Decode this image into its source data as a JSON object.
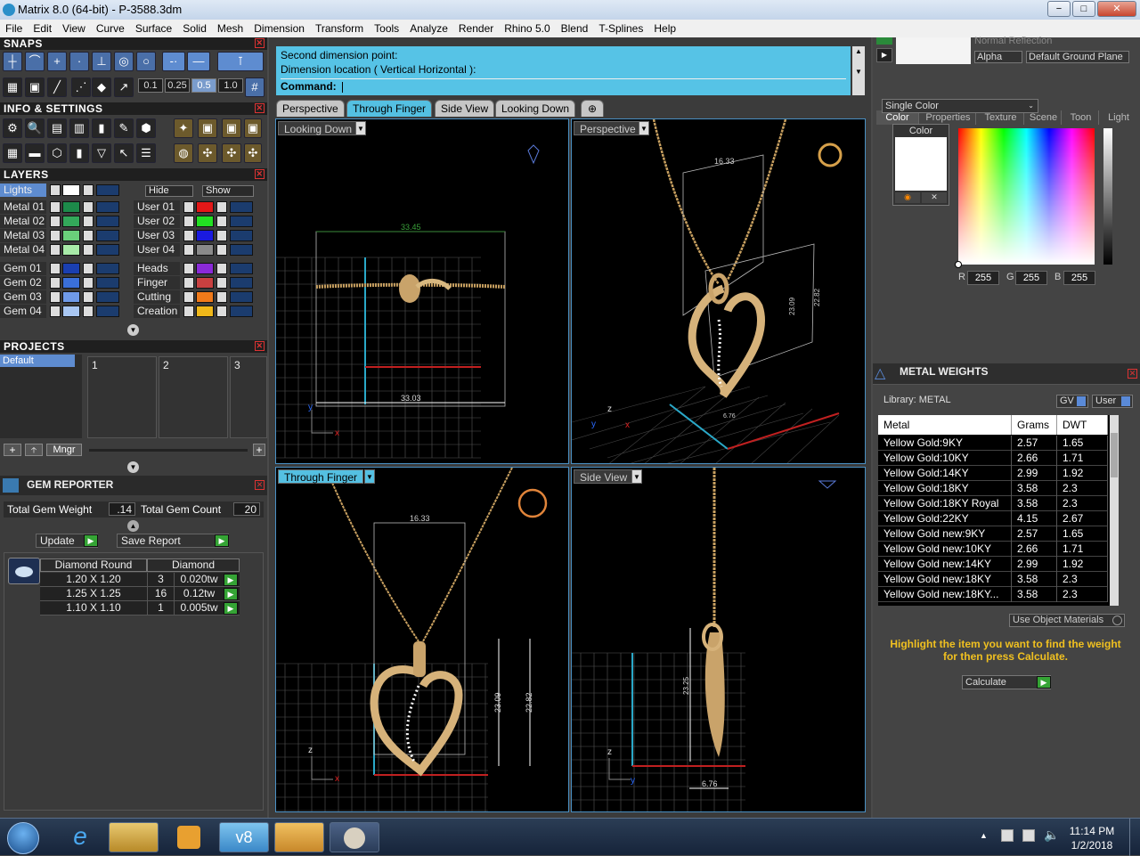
{
  "window": {
    "title": "Matrix 8.0 (64-bit) - P-3588.3dm",
    "minimize": "−",
    "maximize": "□",
    "close": "✕"
  },
  "menu": [
    "File",
    "Edit",
    "View",
    "Curve",
    "Surface",
    "Solid",
    "Mesh",
    "Dimension",
    "Transform",
    "Tools",
    "Analyze",
    "Render",
    "Rhino 5.0",
    "Blend",
    "T-Splines",
    "Help"
  ],
  "snaps": {
    "title": "SNAPS",
    "values": [
      "0.1",
      "0.25",
      "0.5",
      "1.0"
    ]
  },
  "info": {
    "title": "INFO & SETTINGS"
  },
  "layers": {
    "title": "LAYERS",
    "lights": "Lights",
    "hide": "Hide",
    "show": "Show",
    "left": [
      {
        "name": "Metal 01",
        "color": "#1d8a4a"
      },
      {
        "name": "Metal 02",
        "color": "#33a85a"
      },
      {
        "name": "Metal 03",
        "color": "#6ad07a"
      },
      {
        "name": "Metal 04",
        "color": "#a8eaa8"
      },
      {
        "name": "Gem 01",
        "color": "#1a3fb0"
      },
      {
        "name": "Gem 02",
        "color": "#3a6fd8"
      },
      {
        "name": "Gem 03",
        "color": "#6f9ae8"
      },
      {
        "name": "Gem 04",
        "color": "#a8c6f2"
      }
    ],
    "right": [
      {
        "name": "User 01",
        "color": "#e31818"
      },
      {
        "name": "User 02",
        "color": "#22e022"
      },
      {
        "name": "User 03",
        "color": "#1a1ae0"
      },
      {
        "name": "User 04",
        "color": "#8a8a8a"
      },
      {
        "name": "Heads",
        "color": "#8a2ad8"
      },
      {
        "name": "Finger",
        "color": "#c84040"
      },
      {
        "name": "Cutting",
        "color": "#f07a1a"
      },
      {
        "name": "Creation",
        "color": "#f0b81a"
      }
    ]
  },
  "projects": {
    "title": "PROJECTS",
    "default": "Default",
    "slots": [
      "1",
      "2",
      "3"
    ],
    "mngr": "Mngr",
    "add": "+",
    "up": "🡡"
  },
  "gem_reporter": {
    "title": "GEM REPORTER",
    "total_weight_label": "Total Gem Weight",
    "total_weight": ".14",
    "total_count_label": "Total Gem Count",
    "total_count": "20",
    "update": "Update",
    "save_report": "Save Report",
    "header_shape": "Diamond Round",
    "header_type": "Diamond",
    "rows": [
      {
        "size": "1.20 X 1.20",
        "count": "3",
        "weight": "0.020tw"
      },
      {
        "size": "1.25 X 1.25",
        "count": "16",
        "weight": "0.12tw"
      },
      {
        "size": "1.10 X 1.10",
        "count": "1",
        "weight": "0.005tw"
      }
    ]
  },
  "command": {
    "line1": "Second dimension point:",
    "line2": "Dimension location ( Vertical  Horizontal ):",
    "prompt": "Command:"
  },
  "view_tabs": [
    "Perspective",
    "Through Finger",
    "Side View",
    "Looking Down",
    "⊕"
  ],
  "viewports": {
    "tl": {
      "label": "Looking Down",
      "dim_top": "33.45",
      "dim_bottom": "33.03"
    },
    "tr": {
      "label": "Perspective",
      "dim_a": "16.33",
      "dim_b": "23.09",
      "dim_c": "22.82",
      "dim_d": "6.76"
    },
    "bl": {
      "label": "Through Finger",
      "dim_top": "16.33",
      "dim_h1": "23.09",
      "dim_h2": "22.82"
    },
    "br": {
      "label": "Side View",
      "dim_h": "23.25",
      "dim_w": "6.76"
    }
  },
  "axes": {
    "x": "x",
    "y": "y",
    "z": "z"
  },
  "right": {
    "reflection": "Normal Reflection",
    "alpha": "Alpha",
    "ground": "Default Ground Plane",
    "tabs": [
      "Color",
      "Properties",
      "Texture",
      "Scene",
      "Toon",
      "Light"
    ],
    "mode": "Single Color",
    "color_label": "Color",
    "r_label": "R",
    "r": "255",
    "g_label": "G",
    "g": "255",
    "b_label": "B",
    "b": "255"
  },
  "metal_weights": {
    "title": "METAL WEIGHTS",
    "library": "Library: METAL",
    "gv": "GV",
    "user": "User",
    "col_metal": "Metal",
    "col_grams": "Grams",
    "col_dwt": "DWT",
    "rows": [
      {
        "metal": "Yellow Gold:9KY",
        "grams": "2.57",
        "dwt": "1.65"
      },
      {
        "metal": "Yellow Gold:10KY",
        "grams": "2.66",
        "dwt": "1.71"
      },
      {
        "metal": "Yellow Gold:14KY",
        "grams": "2.99",
        "dwt": "1.92"
      },
      {
        "metal": "Yellow Gold:18KY",
        "grams": "3.58",
        "dwt": "2.3"
      },
      {
        "metal": "Yellow Gold:18KY Royal",
        "grams": "3.58",
        "dwt": "2.3"
      },
      {
        "metal": "Yellow Gold:22KY",
        "grams": "4.15",
        "dwt": "2.67"
      },
      {
        "metal": "Yellow Gold new:9KY",
        "grams": "2.57",
        "dwt": "1.65"
      },
      {
        "metal": "Yellow Gold new:10KY",
        "grams": "2.66",
        "dwt": "1.71"
      },
      {
        "metal": "Yellow Gold new:14KY",
        "grams": "2.99",
        "dwt": "1.92"
      },
      {
        "metal": "Yellow Gold new:18KY",
        "grams": "3.58",
        "dwt": "2.3"
      },
      {
        "metal": "Yellow Gold new:18KY...",
        "grams": "3.58",
        "dwt": "2.3"
      }
    ],
    "use_object_materials": "Use Object Materials",
    "hint": "Highlight the item you want to find the weight for then press Calculate.",
    "calculate": "Calculate"
  },
  "taskbar": {
    "time": "11:14 PM",
    "date": "1/2/2018",
    "tray_up": "▲"
  }
}
